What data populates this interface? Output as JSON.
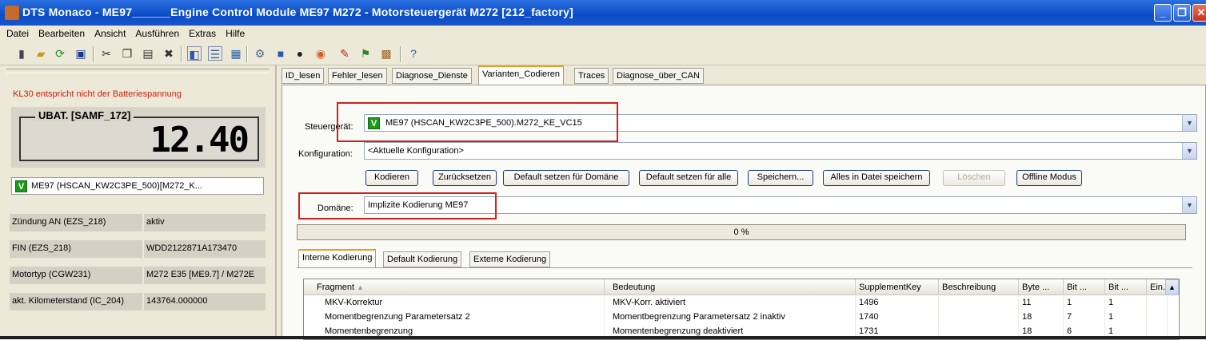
{
  "window": {
    "title": "DTS Monaco   - ME97______Engine Control Module ME97 M272 - Motorsteuergerät M272 [212_factory]"
  },
  "menu": [
    "Datei",
    "Bearbeiten",
    "Ansicht",
    "Ausführen",
    "Extras",
    "Hilfe"
  ],
  "left": {
    "warning": "KL30 entspricht nicht der Batteriespannung",
    "ubat_label": "UBAT. [SAMF_172]",
    "ubat_value": "12.40",
    "variant_badge": "V",
    "variant_text": "ME97 (HSCAN_KW2C3PE_500)[M272_K...",
    "props": [
      {
        "key": "Zündung AN (EZS_218)",
        "value": "aktiv"
      },
      {
        "key": "FIN  (EZS_218)",
        "value": "WDD2122871A173470"
      },
      {
        "key": "Motortyp (CGW231)",
        "value": "M272 E35 [ME9.7] / M272E"
      },
      {
        "key": "akt. Kilometerstand (IC_204)",
        "value": "143764.000000"
      }
    ]
  },
  "tabs": [
    "ID_lesen",
    "Fehler_lesen",
    "Diagnose_Dienste",
    "Varianten_Codieren",
    "Traces",
    "Diagnose_über_CAN"
  ],
  "active_tab": "Varianten_Codieren",
  "form": {
    "steuergeraet_label": "Steuergerät:",
    "steuergeraet_badge": "V",
    "steuergeraet_value": "ME97 (HSCAN_KW2C3PE_500).M272_KE_VC15",
    "konfiguration_label": "Konfiguration:",
    "konfiguration_value": "<Aktuelle Konfiguration>",
    "domaene_label": "Domäne:",
    "domaene_value": "Implizite Kodierung ME97"
  },
  "buttons": [
    "Kodieren",
    "Zurücksetzen",
    "Default setzen für Domäne",
    "Default setzen für alle",
    "Speichern...",
    "Alles in Datei speichern",
    "Löschen",
    "Offline Modus"
  ],
  "progress": {
    "text": "0 %",
    "value": 0
  },
  "subtabs": [
    "Interne Kodierung",
    "Default Kodierung",
    "Externe Kodierung"
  ],
  "grid": {
    "columns": [
      "Fragment",
      "Bedeutung",
      "SupplementKey",
      "Beschreibung",
      "Byte ...",
      "Bit ...",
      "Bit ...",
      "Ein."
    ],
    "rows": [
      [
        "MKV-Korrektur",
        "MKV-Korr. aktiviert",
        "1496",
        "",
        "11",
        "1",
        "1",
        ""
      ],
      [
        "Momentbegrenzung Parametersatz 2",
        "Momentbegrenzung Parametersatz 2 inaktiv",
        "1740",
        "",
        "18",
        "7",
        "1",
        ""
      ],
      [
        "Momentenbegrenzung",
        "Momentenbegrenzung deaktiviert",
        "1731",
        "",
        "18",
        "6",
        "1",
        ""
      ]
    ]
  }
}
